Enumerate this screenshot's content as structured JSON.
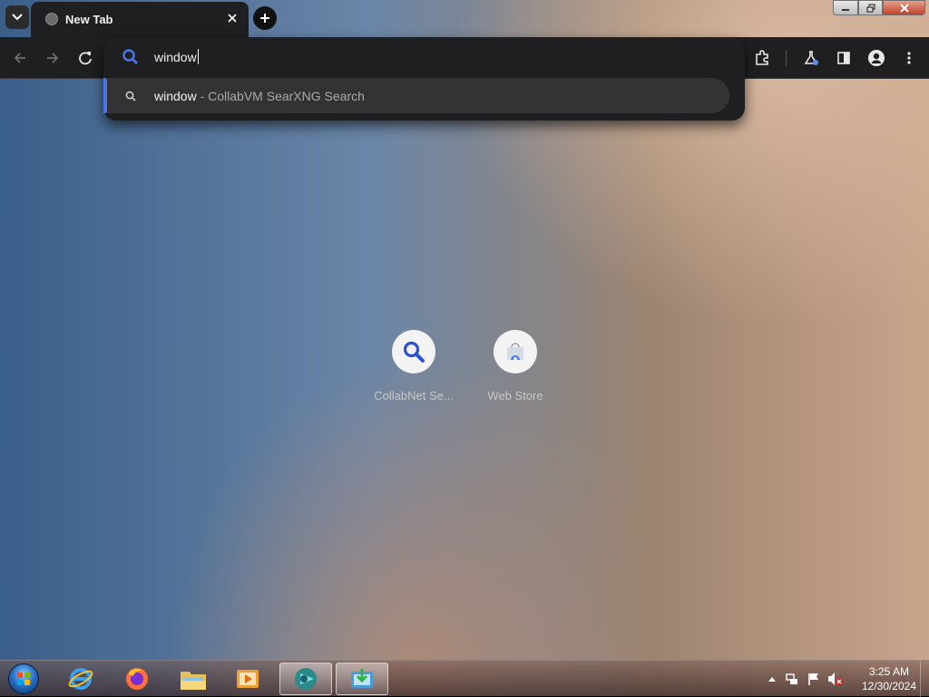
{
  "tabs": [
    {
      "title": "New Tab",
      "active": true
    }
  ],
  "omnibox": {
    "value": "window",
    "suggestion": {
      "query": "window",
      "separator": " - ",
      "description": "CollabVM SearXNG Search"
    }
  },
  "shortcuts": [
    {
      "label": "CollabNet Se...",
      "icon": "magnifier-icon"
    },
    {
      "label": "Web Store",
      "icon": "web-store-icon"
    }
  ],
  "taskbar": {
    "pinned": [
      "start-orb",
      "internet-explorer-icon",
      "firefox-icon",
      "file-explorer-icon",
      "media-player-icon",
      "chrome-app-icon",
      "downloader-icon"
    ],
    "clock": {
      "time": "3:25 AM",
      "date": "12/30/2024"
    }
  },
  "colors": {
    "accent": "#4a78e6",
    "chrome_dark": "#1f1f21",
    "suggestion_bg": "#333336"
  }
}
